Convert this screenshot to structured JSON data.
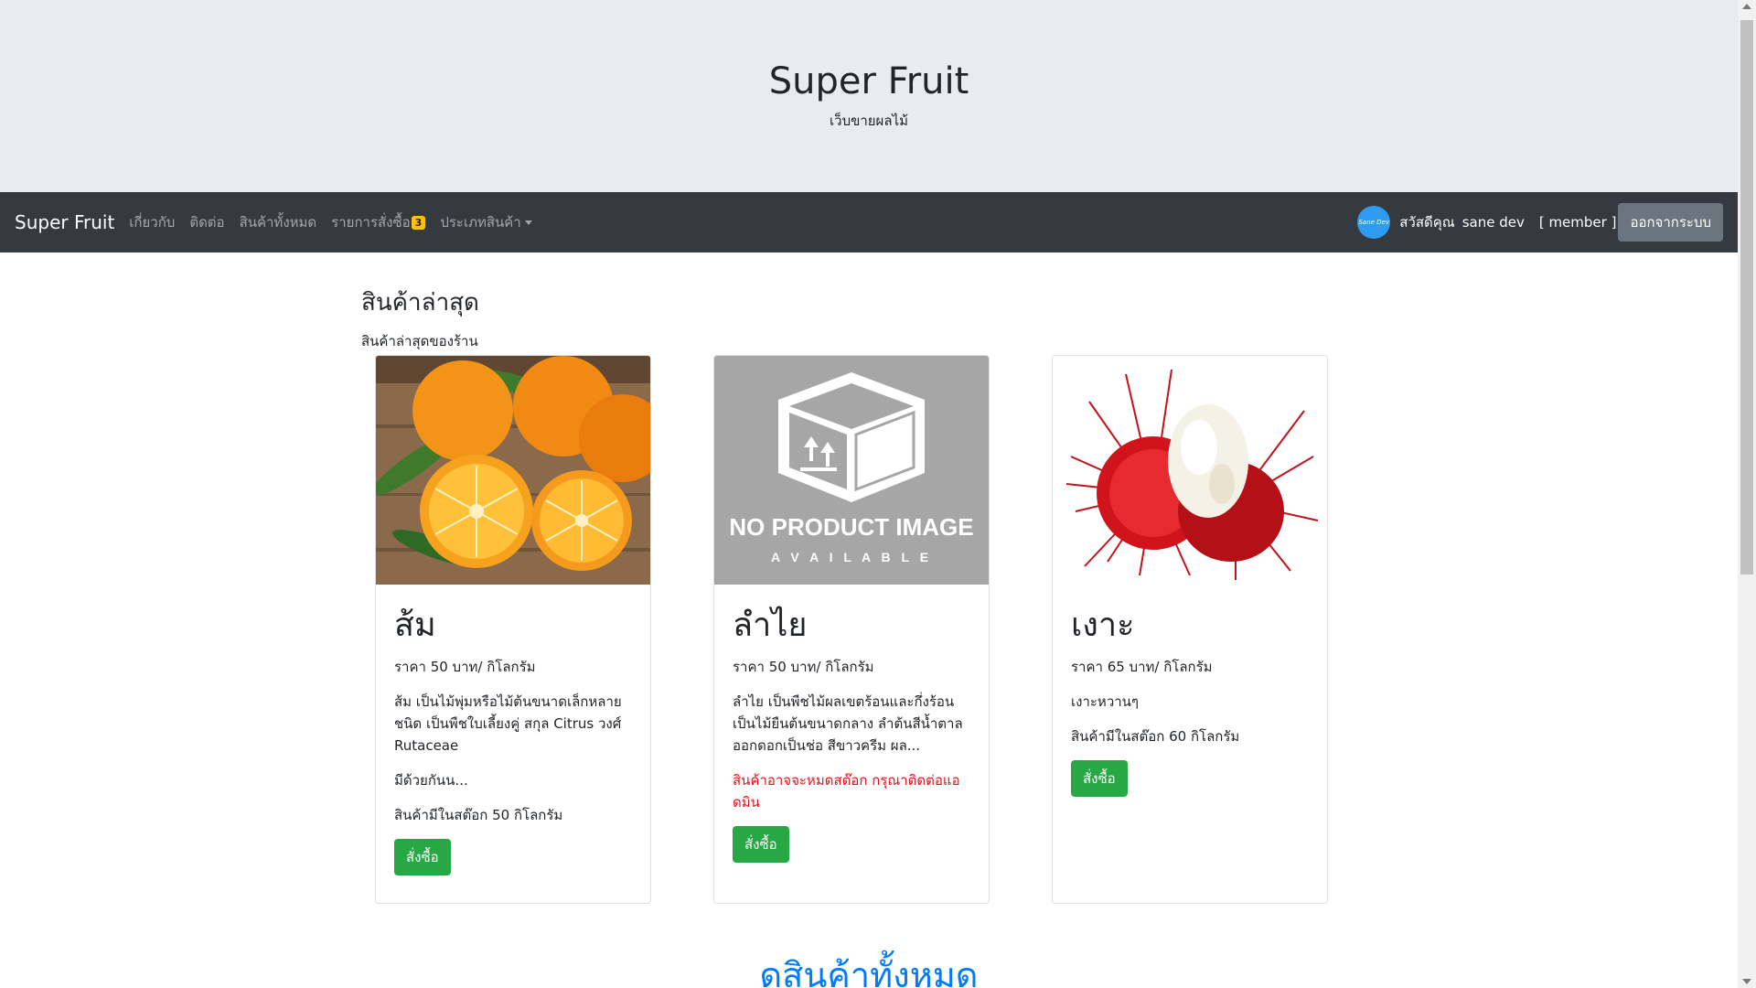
{
  "header": {
    "title": "Super Fruit",
    "subtitle": "เว็บขายผลไม้"
  },
  "navbar": {
    "brand": "Super Fruit",
    "links": [
      "เกี่ยวกับ",
      "ติดต่อ",
      "สินค้าทั้งหมด",
      "รายการสั่งซื้อ",
      "ประเภทสินค้า"
    ],
    "orders_badge": "3",
    "greeting": "สวัสดีคุณ",
    "user_name": "sane dev",
    "role": "[ member ]",
    "logout_label": "ออกจากระบบ",
    "avatar_text": "Sane Dev"
  },
  "section": {
    "title": "สินค้าล่าสุด",
    "subtitle": "สินค้าล่าสุดของร้าน"
  },
  "products": [
    {
      "name": "ส้ม",
      "price": "ราคา 50 บาท/ กิโลกรัม",
      "description": "ส้ม เป็นไม้พุ่มหรือไม้ต้นขนาดเล็กหลายชนิด เป็นพืชใบเลี้ยงคู่ สกุล Citrus วงศ์ Rutaceae",
      "more": "มีด้วยกันน...",
      "stock": "สินค้ามีในสต๊อก 50 กิโลกรัม",
      "buy_label": "สั่งซื้อ"
    },
    {
      "name": "ลำไย",
      "price": "ราคา 50 บาท/ กิโลกรัม",
      "description": "ลำไย เป็นพืชไม้ผลเขตร้อนและกึ่งร้อน เป็นไม้ยืนต้นขนาดกลาง ลำต้นสีน้ำตาล ออกดอกเป็นช่อ สีขาวครีม ผล...",
      "warning": "สินค้าอาจจะหมดสต๊อก กรุณาติดต่อแอดมิน",
      "no_image_title": "NO PRODUCT IMAGE",
      "no_image_sub": "A V A I L A B L E",
      "buy_label": "สั่งซื้อ"
    },
    {
      "name": "เงาะ",
      "price": "ราคา 65 บาท/ กิโลกรัม",
      "description": "เงาะหวานๆ",
      "stock": "สินค้ามีในสต๊อก 60 กิโลกรัม",
      "buy_label": "สั่งซื้อ"
    }
  ],
  "see_all": "ดูสินค้าทั้งหมด",
  "colors": {
    "navbar": "#343a40",
    "jumbotron": "#e9ecef",
    "buy_button": "#28a745",
    "logout_button": "#6c757d",
    "badge": "#ffc107",
    "link": "#007bff",
    "warning_text": "#e4111d"
  }
}
